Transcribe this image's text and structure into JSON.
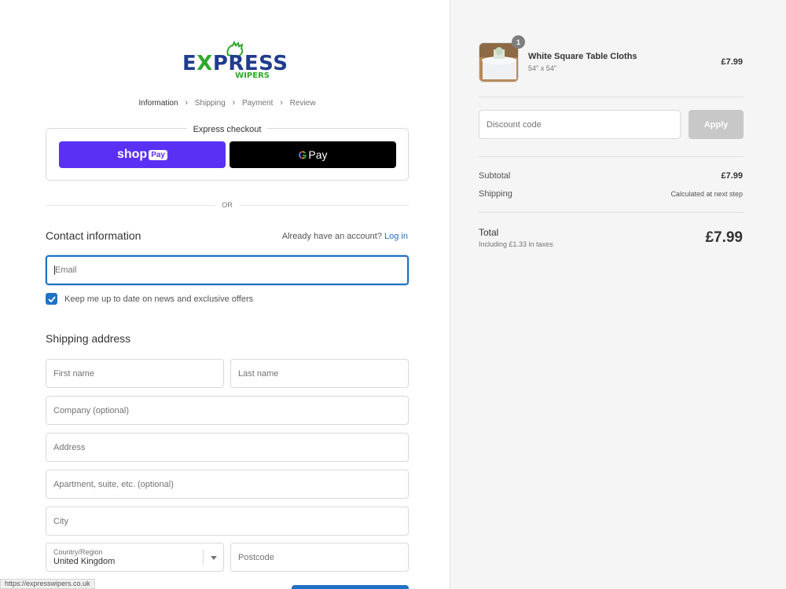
{
  "logo": {
    "word_a": "E",
    "word_x": "X",
    "word_b": "PRESS",
    "sub": "WIPERS"
  },
  "breadcrumb": [
    {
      "label": "Information",
      "current": true
    },
    {
      "label": "Shipping"
    },
    {
      "label": "Payment"
    },
    {
      "label": "Review"
    }
  ],
  "express": {
    "title": "Express checkout",
    "shop_pay": {
      "shop": "shop",
      "pay": "Pay"
    },
    "gpay": {
      "g": "G",
      "pay": "Pay"
    }
  },
  "or_label": "OR",
  "contact": {
    "title": "Contact information",
    "account_prompt": "Already have an account?",
    "login_label": "Log in",
    "email_placeholder": "Email",
    "newsletter_label": "Keep me up to date on news and exclusive offers",
    "newsletter_checked": true
  },
  "shipping": {
    "title": "Shipping address",
    "first_name": "First name",
    "last_name": "Last name",
    "company": "Company (optional)",
    "address": "Address",
    "apartment": "Apartment, suite, etc. (optional)",
    "city": "City",
    "country_label": "Country/Region",
    "country_value": "United Kingdom",
    "postcode": "Postcode"
  },
  "status_url": "https://expresswipers.co.uk",
  "summary": {
    "product": {
      "name": "White Square Table Cloths",
      "variant": "54\" x 54\"",
      "price": "£7.99",
      "quantity": "1"
    },
    "discount_placeholder": "Discount code",
    "apply_label": "Apply",
    "subtotal_label": "Subtotal",
    "subtotal_value": "£7.99",
    "shipping_label": "Shipping",
    "shipping_value": "Calculated at next step",
    "total_label": "Total",
    "tax_note": "Including £1.33 in taxes",
    "total_value": "£7.99"
  },
  "colors": {
    "accent": "#1f72c4",
    "shop_pay": "#5a31f4",
    "brand_blue": "#1f3c8e",
    "brand_green": "#2fa82a"
  }
}
